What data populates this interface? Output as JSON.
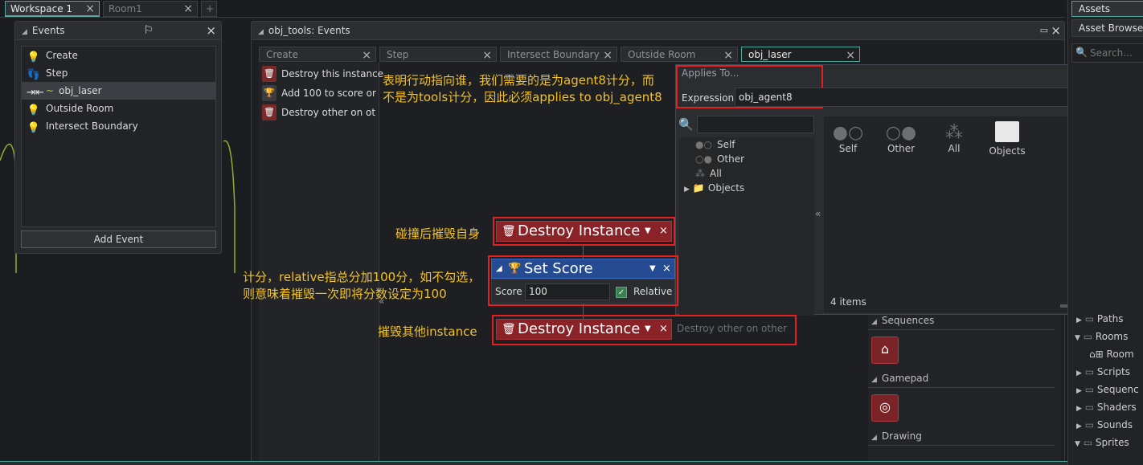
{
  "workspace_tabs": [
    {
      "label": "Workspace 1",
      "active": true
    },
    {
      "label": "Room1",
      "active": false
    }
  ],
  "add_tab_label": "+",
  "events_panel": {
    "title": "Events",
    "items": [
      {
        "label": "Create",
        "icon": "lightbulb-icon"
      },
      {
        "label": "Step",
        "icon": "footsteps-icon"
      },
      {
        "label": "obj_laser",
        "icon": "collision-icon",
        "selected": true
      },
      {
        "label": "Outside Room",
        "icon": "lightbulb-icon"
      },
      {
        "label": "Intersect Boundary",
        "icon": "lightbulb-icon"
      }
    ],
    "add_event_label": "Add Event"
  },
  "editor": {
    "title": "obj_tools: Events",
    "event_tabs": [
      {
        "label": "Create",
        "active": false
      },
      {
        "label": "Step",
        "active": false
      },
      {
        "label": "Intersect Boundary",
        "active": false
      },
      {
        "label": "Outside Room",
        "active": false
      },
      {
        "label": "obj_laser",
        "active": true
      }
    ],
    "actions_list": [
      {
        "label": "Destroy this instance"
      },
      {
        "label": "Add 100 to score or"
      },
      {
        "label": "Destroy other on ot"
      }
    ]
  },
  "applies_to": {
    "header": "Applies To...",
    "expression_label": "Expression",
    "expression_value": "obj_agent8",
    "tree": [
      "Self",
      "Other",
      "All",
      "Objects"
    ],
    "icons": [
      "Self",
      "Other",
      "All",
      "Objects"
    ],
    "items_count": "4 items"
  },
  "blocks": {
    "destroy1": "Destroy Instance",
    "set_score": "Set Score",
    "score_label": "Score",
    "score_value": "100",
    "relative_label": "Relative",
    "relative_checked": true,
    "destroy2": "Destroy Instance",
    "destroy2_desc": "Destroy other on other"
  },
  "annotations": {
    "note1_line1": "表明行动指向谁，我们需要的是为agent8计分，而",
    "note1_line2": "不是为tools计分，因此必须applies to obj_agent8",
    "note2": "碰撞后摧毁自身",
    "note3_line1": "计分，relative指总分加100分，如不勾选，",
    "note3_line2": "则意味着摧毁一次即将分数设定为100",
    "note4": "摧毁其他instance"
  },
  "toolbox": {
    "sections": [
      "Sequences",
      "Gamepad",
      "Drawing"
    ]
  },
  "assets": {
    "tab": "Assets",
    "browser": "Asset Browser",
    "search_placeholder": "Search...",
    "rows": [
      {
        "label": "Paths",
        "expanded": false
      },
      {
        "label": "Rooms",
        "expanded": true
      },
      {
        "label": "Room",
        "child": true
      },
      {
        "label": "Scripts",
        "expanded": false
      },
      {
        "label": "Sequenc",
        "expanded": false
      },
      {
        "label": "Shaders",
        "expanded": false
      },
      {
        "label": "Sounds",
        "expanded": false
      },
      {
        "label": "Sprites",
        "expanded": true
      }
    ]
  },
  "colors": {
    "accent": "#4aa89c",
    "annotation": "#f2c227",
    "highlight_box": "#e52020",
    "destroy_block": "#8a2328",
    "score_block": "#254b93"
  }
}
